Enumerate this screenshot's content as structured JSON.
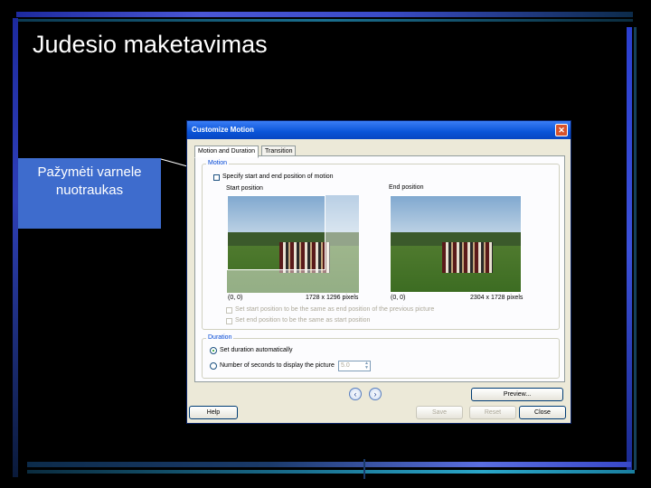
{
  "slide": {
    "title": "Judesio maketavimas",
    "callout": "Pažymėti varnele nuotraukas"
  },
  "colors": {
    "background": "#000000",
    "callout": "#3e6ccd",
    "titlebar": "#0a54d8",
    "group_label": "#0046d5"
  },
  "dialog": {
    "title": "Customize Motion",
    "close_icon": "close-icon",
    "tabs": [
      {
        "label": "Motion and Duration",
        "selected": true
      },
      {
        "label": "Transition",
        "selected": false
      }
    ],
    "motion": {
      "group_label": "Motion",
      "specify_checkbox_label": "Specify start and end position of motion",
      "specify_checked": false,
      "start_label": "Start position",
      "end_label": "End position",
      "start_coords": "(0, 0)",
      "start_size": "1728 x 1296 pixels",
      "end_coords": "(0, 0)",
      "end_size": "2304 x 1728 pixels",
      "same_as_previous_label": "Set start position to be the same as end position of the previous picture",
      "end_same_as_start_label": "Set end position to be the same as start position"
    },
    "duration": {
      "group_label": "Duration",
      "auto_label": "Set duration automatically",
      "auto_selected": true,
      "seconds_label": "Number of seconds to display the picture",
      "seconds_value": "5.0"
    },
    "nav": {
      "prev_icon": "chevron-left-icon",
      "next_icon": "chevron-right-icon"
    },
    "buttons": {
      "preview": "Preview...",
      "help": "Help",
      "save": "Save",
      "reset": "Reset",
      "close": "Close"
    }
  }
}
